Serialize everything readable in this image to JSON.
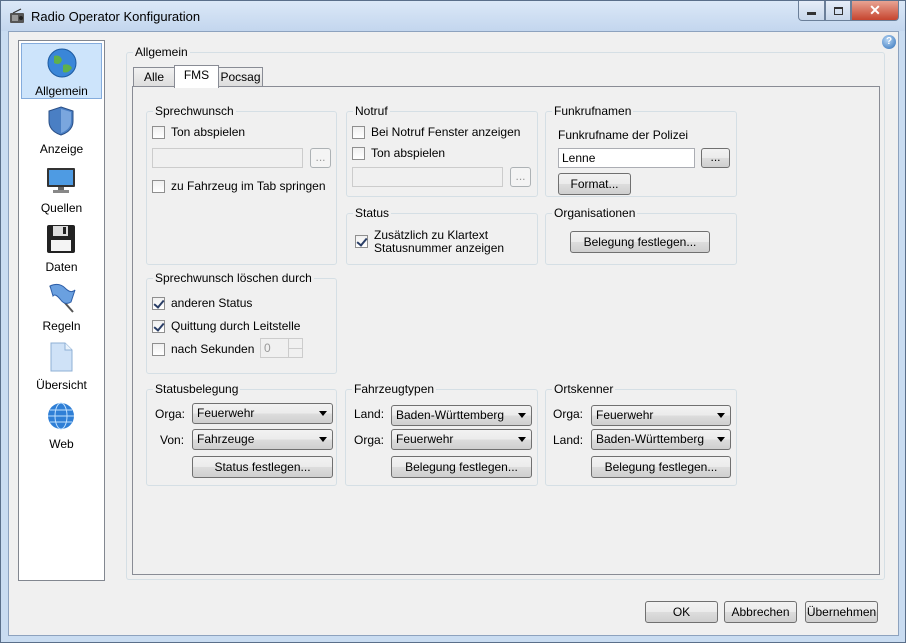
{
  "window": {
    "title": "Radio Operator Konfiguration"
  },
  "sidebar": {
    "items": [
      {
        "label": "Allgemein"
      },
      {
        "label": "Anzeige"
      },
      {
        "label": "Quellen"
      },
      {
        "label": "Daten"
      },
      {
        "label": "Regeln"
      },
      {
        "label": "Übersicht"
      },
      {
        "label": "Web"
      }
    ]
  },
  "main": {
    "group_title": "Allgemein",
    "tabs": [
      {
        "label": "Alle"
      },
      {
        "label": "FMS"
      },
      {
        "label": "Pocsag"
      }
    ],
    "sprechwunsch": {
      "title": "Sprechwunsch",
      "ton_abspielen": "Ton abspielen",
      "browse": "...",
      "fahrzeug_springen": "zu Fahrzeug im Tab springen"
    },
    "notruf": {
      "title": "Notruf",
      "fenster_anzeigen": "Bei Notruf Fenster anzeigen",
      "ton_abspielen": "Ton abspielen",
      "browse": "..."
    },
    "funkrufnamen": {
      "title": "Funkrufnamen",
      "label": "Funkrufname der Polizei",
      "value": "Lenne",
      "browse": "...",
      "format_button": "Format..."
    },
    "status": {
      "title": "Status",
      "klartext_line1": "Zusätzlich zu Klartext",
      "klartext_line2": "Statusnummer anzeigen"
    },
    "organisationen": {
      "title": "Organisationen",
      "button": "Belegung festlegen..."
    },
    "loeschen": {
      "title": "Sprechwunsch löschen durch",
      "anderen_status": "anderen Status",
      "quittung": "Quittung durch Leitstelle",
      "nach_sekunden": "nach Sekunden",
      "seconds_value": "0"
    },
    "statusbelegung": {
      "title": "Statusbelegung",
      "orga_label": "Orga:",
      "orga_value": "Feuerwehr",
      "von_label": "Von:",
      "von_value": "Fahrzeuge",
      "button": "Status festlegen..."
    },
    "fahrzeugtypen": {
      "title": "Fahrzeugtypen",
      "land_label": "Land:",
      "land_value": "Baden-Württemberg",
      "orga_label": "Orga:",
      "orga_value": "Feuerwehr",
      "button": "Belegung festlegen..."
    },
    "ortskenner": {
      "title": "Ortskenner",
      "orga_label": "Orga:",
      "orga_value": "Feuerwehr",
      "land_label": "Land:",
      "land_value": "Baden-Württemberg",
      "button": "Belegung festlegen..."
    }
  },
  "footer": {
    "ok": "OK",
    "cancel": "Abbrechen",
    "apply": "Übernehmen"
  }
}
